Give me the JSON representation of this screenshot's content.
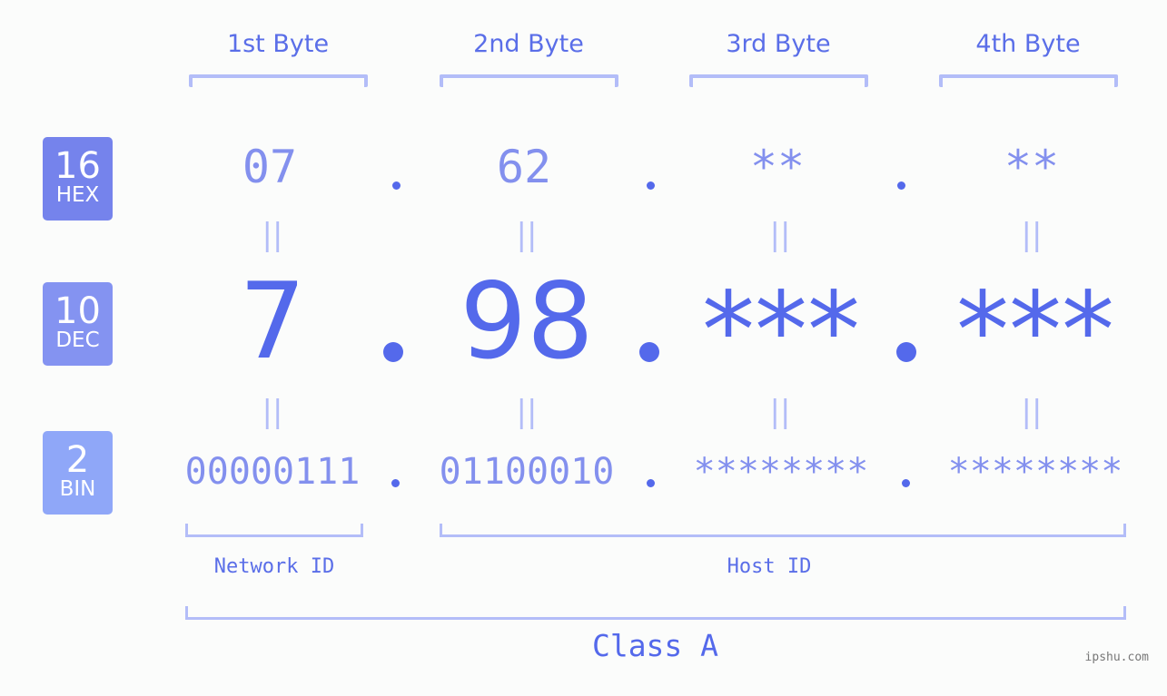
{
  "bytes": [
    {
      "header": "1st Byte",
      "hex": "07",
      "dec": "7",
      "bin": "00000111"
    },
    {
      "header": "2nd Byte",
      "hex": "62",
      "dec": "98",
      "bin": "01100010"
    },
    {
      "header": "3rd Byte",
      "hex": "**",
      "dec": "***",
      "bin": "********"
    },
    {
      "header": "4th Byte",
      "hex": "**",
      "dec": "***",
      "bin": "********"
    }
  ],
  "badges": {
    "hex": {
      "base": "16",
      "label": "HEX",
      "color": "#7583ec"
    },
    "dec": {
      "base": "10",
      "label": "DEC",
      "color": "#8493f1"
    },
    "bin": {
      "base": "2",
      "label": "BIN",
      "color": "#8fa7f8"
    }
  },
  "equals_sign": "||",
  "sections": {
    "network_id": "Network ID",
    "host_id": "Host ID",
    "class": "Class A"
  },
  "watermark": "ipshu.com",
  "colors": {
    "accent": "#5469eb",
    "secondary": "#8390ee",
    "bracket": "#b3bdf8",
    "background": "#fbfcfb"
  }
}
